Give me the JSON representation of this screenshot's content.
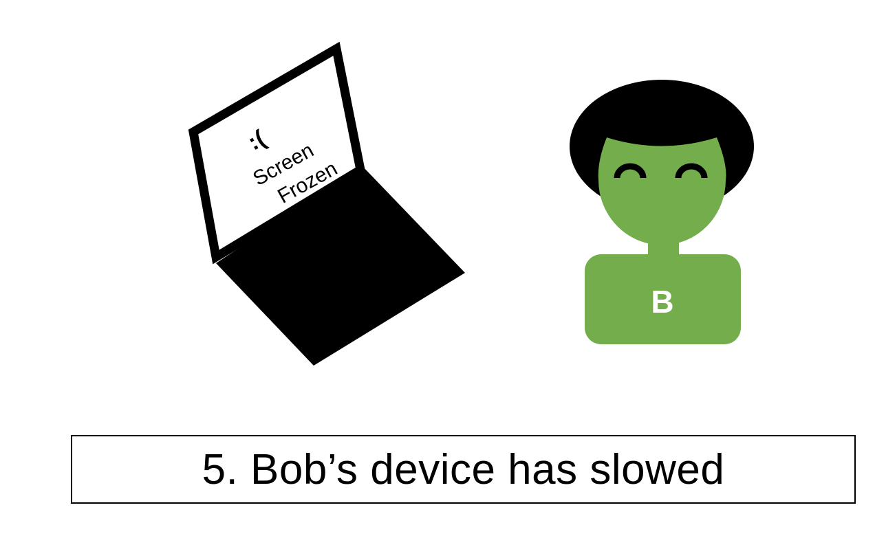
{
  "laptop": {
    "emoticon": ":(",
    "line1": "Screen",
    "line2": "Frozen"
  },
  "person": {
    "badge_letter": "B",
    "skin_color": "#74AD4C",
    "hair_color": "#000000"
  },
  "caption": {
    "text": "5. Bob’s device has slowed"
  }
}
